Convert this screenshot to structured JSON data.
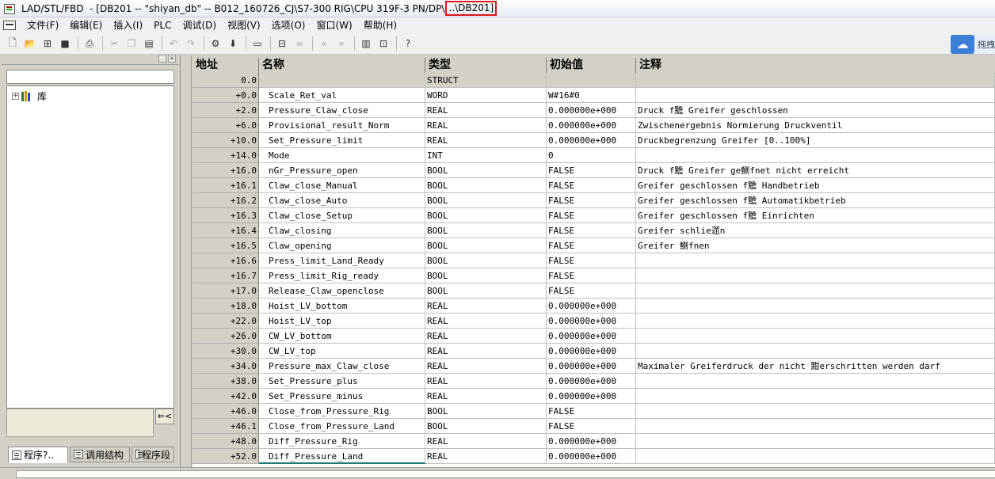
{
  "window": {
    "title_prefix": "LAD/STL/FBD  - [DB201 -- \"shiyan_db\" -- B012_160726_CJ\\S7-300 RIG\\CPU 319F-3 PN/DP\\",
    "title_highlight": "..\\DB201]"
  },
  "menu": [
    "文件(F)",
    "编辑(E)",
    "插入(I)",
    "PLC",
    "调试(D)",
    "视图(V)",
    "选项(O)",
    "窗口(W)",
    "帮助(H)"
  ],
  "toolbar": {
    "icons": [
      "new-file-icon",
      "open-folder-icon",
      "network-icon",
      "save-icon",
      "print-icon",
      "cut-icon",
      "copy-icon",
      "paste-icon",
      "undo-icon",
      "redo-icon",
      "accessible-nodes-icon",
      "download-icon",
      "overview-icon",
      "monitor-icon",
      "monitor-glasses-icon",
      "prev-error-icon",
      "next-error-icon",
      "panel-icon",
      "zoom-icon",
      "help-icon"
    ],
    "cloud_tag": "拖拽"
  },
  "left_panel": {
    "tree_items": [
      {
        "label": "库",
        "icon": "library-books-icon"
      }
    ],
    "info_button": "⇐<",
    "tabs": [
      "程序?..",
      "调用结构",
      "程序段"
    ]
  },
  "table": {
    "headers": {
      "addr": "地址",
      "name": "名称",
      "type": "类型",
      "init": "初始值",
      "comment": "注释"
    },
    "rows": [
      {
        "addr": "0.0",
        "name": "",
        "type": "STRUCT",
        "init": "",
        "comment": ""
      },
      {
        "addr": "+0.0",
        "name": "Scale_Ret_val",
        "type": "WORD",
        "init": "W#16#0",
        "comment": ""
      },
      {
        "addr": "+2.0",
        "name": "Pressure_Claw_close",
        "type": "REAL",
        "init": "0.000000e+000",
        "comment": "Druck f黵 Greifer geschlossen"
      },
      {
        "addr": "+6.0",
        "name": "Provisional_result_Norm",
        "type": "REAL",
        "init": "0.000000e+000",
        "comment": "Zwischenergebnis Normierung Druckventil"
      },
      {
        "addr": "+10.0",
        "name": "Set_Pressure_limit",
        "type": "REAL",
        "init": "0.000000e+000",
        "comment": "Druckbegrenzung Greifer [0..100%]"
      },
      {
        "addr": "+14.0",
        "name": "Mode",
        "type": "INT",
        "init": "0",
        "comment": ""
      },
      {
        "addr": "+16.0",
        "name": "nGr_Pressure_open",
        "type": "BOOL",
        "init": "FALSE",
        "comment": "Druck f黵 Greifer ge鰂fnet nicht erreicht"
      },
      {
        "addr": "+16.1",
        "name": "Claw_close_Manual",
        "type": "BOOL",
        "init": "FALSE",
        "comment": "Greifer geschlossen f黵 Handbetrieb"
      },
      {
        "addr": "+16.2",
        "name": "Claw_close_Auto",
        "type": "BOOL",
        "init": "FALSE",
        "comment": "Greifer geschlossen f黵 Automatikbetrieb"
      },
      {
        "addr": "+16.3",
        "name": "Claw_close_Setup",
        "type": "BOOL",
        "init": "FALSE",
        "comment": "Greifer geschlossen f黵 Einrichten"
      },
      {
        "addr": "+16.4",
        "name": "Claw_closing",
        "type": "BOOL",
        "init": "FALSE",
        "comment": "Greifer schlie遝n"
      },
      {
        "addr": "+16.5",
        "name": "Claw_opening",
        "type": "BOOL",
        "init": "FALSE",
        "comment": "Greifer 鰂fnen"
      },
      {
        "addr": "+16.6",
        "name": "Press_limit_Land_Ready",
        "type": "BOOL",
        "init": "FALSE",
        "comment": ""
      },
      {
        "addr": "+16.7",
        "name": "Press_limit_Rig_ready",
        "type": "BOOL",
        "init": "FALSE",
        "comment": ""
      },
      {
        "addr": "+17.0",
        "name": "Release_Claw_openclose",
        "type": "BOOL",
        "init": "FALSE",
        "comment": ""
      },
      {
        "addr": "+18.0",
        "name": "Hoist_LV_bottom",
        "type": "REAL",
        "init": "0.000000e+000",
        "comment": ""
      },
      {
        "addr": "+22.0",
        "name": "Hoist_LV_top",
        "type": "REAL",
        "init": "0.000000e+000",
        "comment": ""
      },
      {
        "addr": "+26.0",
        "name": "CW_LV_bottom",
        "type": "REAL",
        "init": "0.000000e+000",
        "comment": ""
      },
      {
        "addr": "+30.0",
        "name": "CW_LV_top",
        "type": "REAL",
        "init": "0.000000e+000",
        "comment": ""
      },
      {
        "addr": "+34.0",
        "name": "Pressure_max_Claw_close",
        "type": "REAL",
        "init": "0.000000e+000",
        "comment": "Maximaler Greiferdruck der nicht 黚erschritten werden darf"
      },
      {
        "addr": "+38.0",
        "name": "Set_Pressure_plus",
        "type": "REAL",
        "init": "0.000000e+000",
        "comment": ""
      },
      {
        "addr": "+42.0",
        "name": "Set_Pressure_minus",
        "type": "REAL",
        "init": "0.000000e+000",
        "comment": ""
      },
      {
        "addr": "+46.0",
        "name": "Close_from_Pressure_Rig",
        "type": "BOOL",
        "init": "FALSE",
        "comment": ""
      },
      {
        "addr": "+46.1",
        "name": "Close_from_Pressure_Land",
        "type": "BOOL",
        "init": "FALSE",
        "comment": ""
      },
      {
        "addr": "+48.0",
        "name": "Diff_Pressure_Rig",
        "type": "REAL",
        "init": "0.000000e+000",
        "comment": ""
      },
      {
        "addr": "+52.0",
        "name": "Diff_Pressure_Land",
        "type": "REAL",
        "init": "0.000000e+000",
        "comment": ""
      }
    ]
  },
  "colors": {
    "title_highlight_border": "#e0161a",
    "cloud_button": "#3c7fd6",
    "selected_row_underline": "#1a7a7a"
  }
}
